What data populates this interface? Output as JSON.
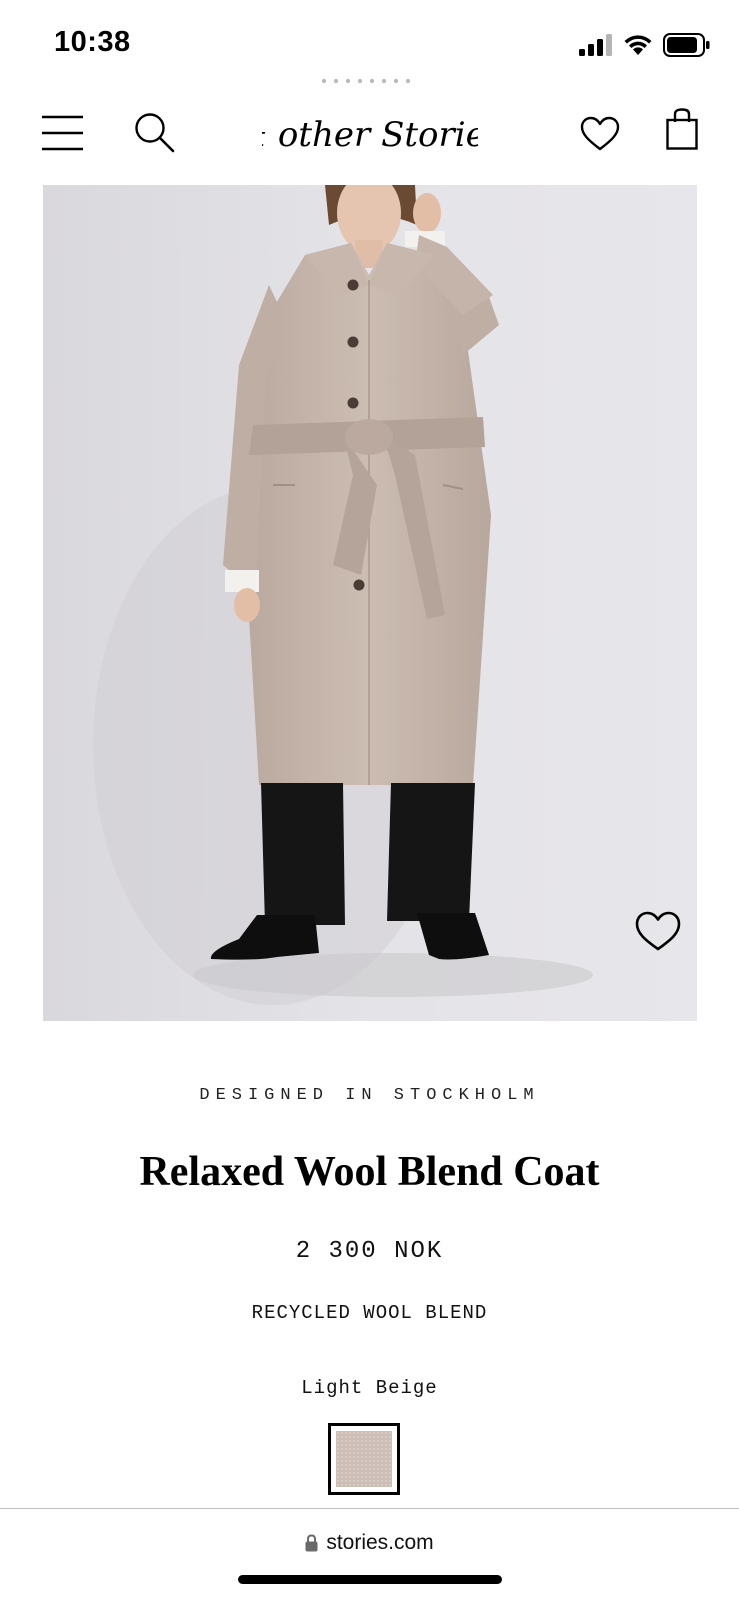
{
  "status_bar": {
    "time": "10:38",
    "icons": [
      "cellular-signal-icon",
      "wifi-icon",
      "battery-icon"
    ]
  },
  "header": {
    "logo_text": "& other Stories",
    "icons": [
      "hamburger-menu-icon",
      "search-icon",
      "heart-icon",
      "shopping-bag-icon"
    ]
  },
  "product": {
    "tagline": "DESIGNED IN STOCKHOLM",
    "title": "Relaxed Wool Blend Coat",
    "price": "2 300 NOK",
    "material": "RECYCLED WOOL BLEND",
    "color_name": "Light Beige",
    "swatch_color": "#cdbfb7",
    "image_wishlist_icon": "heart-outline-icon"
  },
  "browser": {
    "url": "stories.com",
    "lock_icon": "lock-icon"
  },
  "colors": {
    "background": "#ffffff",
    "text": "#000000",
    "image_background": "#e3e2e5",
    "coat": "#c8b8ae"
  }
}
